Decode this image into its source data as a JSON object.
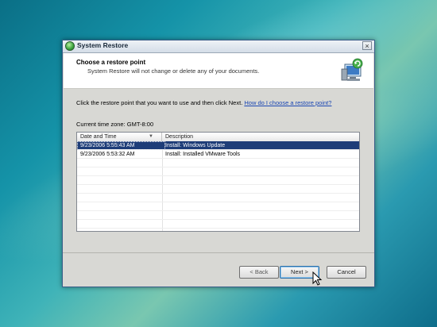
{
  "window": {
    "title": "System Restore",
    "close_glyph": "×"
  },
  "header": {
    "title": "Choose a restore point",
    "subtitle": "System Restore will not change or delete any of your documents."
  },
  "body": {
    "instruction": "Click the restore point that you want to use and then click Next.",
    "help_link": "How do I choose a restore point?",
    "timezone": "Current time zone: GMT-8:00"
  },
  "table": {
    "columns": [
      "Date and Time",
      "Description"
    ],
    "sort_indicator": "▼",
    "rows": [
      {
        "date": "9/23/2006 5:55:43 AM",
        "description": "Install: Windows Update",
        "selected": true
      },
      {
        "date": "9/23/2006 5:53:32 AM",
        "description": "Install: Installed VMware Tools",
        "selected": false
      }
    ]
  },
  "buttons": {
    "back": "< Back",
    "next": "Next >",
    "cancel": "Cancel"
  },
  "icons": {
    "title": "system-restore-icon",
    "header": "computer-restore-icon"
  }
}
